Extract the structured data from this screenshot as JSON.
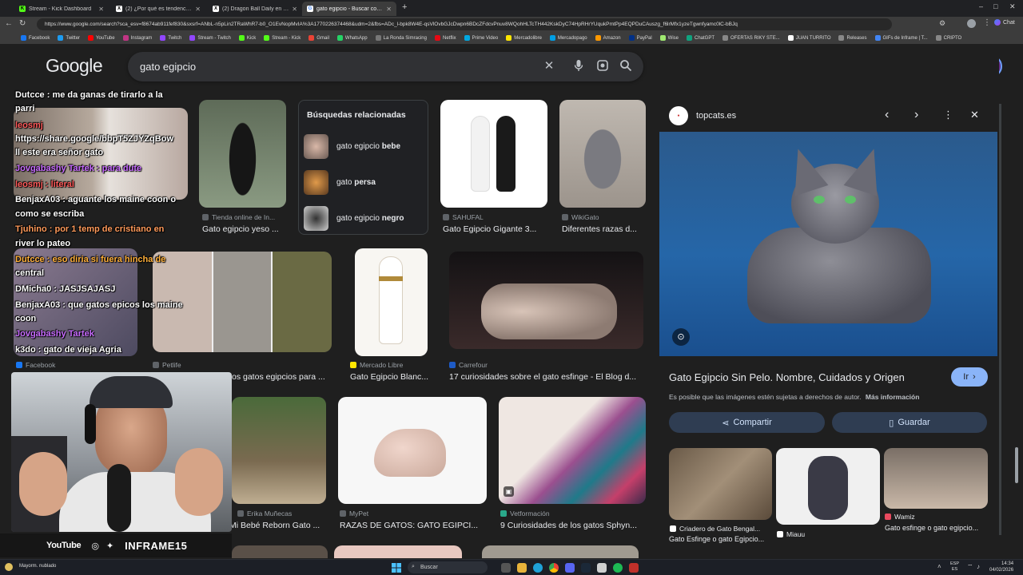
{
  "browser": {
    "tabs": [
      {
        "label": "Stream - Kick Dashboard",
        "icon": "kick-icon"
      },
      {
        "label": "(2) ¿Por qué es tendencia? (@porq",
        "icon": "x-icon"
      },
      {
        "label": "(2) Dragon Ball Daily en X: \"Beerus",
        "icon": "x-icon"
      },
      {
        "label": "gato egipcio - Buscar con Google",
        "icon": "google-icon"
      }
    ],
    "url": "https://www.google.com/search?sca_esv=f8674ab911fef830&sxsrf=ANbL-n5pLin2TRaWhR7-b0_O1EvNopMvIA%3A1770226374468&udm=2&fbs=ADc_l-bpk8W4E-qsVlOvbGJcDwpn6BDcZFdcvPnuv8WQohHLTcTH442KskDyC74HpRHrYUqukPmtPp4EQPDuCAuszg_f6lrMfx1yzeTgwnfyamc0lC-bBJq",
    "bookmarks": [
      "Facebook",
      "Twitter",
      "YouTube",
      "Instagram",
      "Twitch",
      "Stream - Twitch",
      "Kick",
      "Stream - Kick",
      "Gmail",
      "WhatsApp",
      "La Ronda Simracing",
      "Netflix",
      "Prime Video",
      "Mercadolibre",
      "Mercadopago",
      "Amazon",
      "PayPal",
      "Wise",
      "ChatGPT",
      "OFERTAS RIKY STE...",
      "JUAN TURRITO",
      "Releases",
      "GIFs de Inframe | T...",
      "CRIPTO"
    ],
    "chat_label": "Chat"
  },
  "google": {
    "logo": "Google",
    "query": "gato egipcio",
    "related": {
      "title": "Búsquedas relacionadas",
      "items": [
        {
          "prefix": "gato egipcio ",
          "bold": "bebe"
        },
        {
          "prefix": "gato ",
          "bold": "persa"
        },
        {
          "prefix": "gato egipcio ",
          "bold": "negro"
        }
      ]
    },
    "results": [
      {
        "source": "Tienda online de In...",
        "title": "Gato egipcio yeso ..."
      },
      {
        "source": "SAHUFAL",
        "title": "Gato Egipcio Gigante 3..."
      },
      {
        "source": "WikiGato",
        "title": "Diferentes razas d..."
      },
      {
        "source": "Facebook",
        "title": ""
      },
      {
        "source": "Petlife",
        "title": "os gatos egipcios para ..."
      },
      {
        "source": "Mercado Libre",
        "title": "Gato Egipcio Blanc..."
      },
      {
        "source": "Carrefour",
        "title": "17 curiosidades sobre el gato esfinge - El Blog d..."
      },
      {
        "source": "Erika Muñecas",
        "title": "Mi Bebé Reborn Gato ..."
      },
      {
        "source": "MyPet",
        "title": "RAZAS DE GATOS: GATO EGIPCI..."
      },
      {
        "source": "Vetformación",
        "title": "9 Curiosidades de los gatos Sphyn..."
      }
    ]
  },
  "panel": {
    "site": "topcats.es",
    "title": "Gato Egipcio Sin Pelo. Nombre, Cuidados y Origen",
    "go_label": "Ir",
    "copyright": "Es posible que las imágenes estén sujetas a derechos de autor.",
    "more_info": "Más información",
    "share_label": "Compartir",
    "save_label": "Guardar",
    "related": [
      {
        "source": "Criadero de Gato Bengal...",
        "title": "Gato Esfinge o gato Egipcio..."
      },
      {
        "source": "Miauu",
        "title": ""
      },
      {
        "source": "Wamiz",
        "title": "Gato esfinge o gato egipcio..."
      }
    ]
  },
  "stream": {
    "chat": [
      "Dutcce : me da ganas de tirarlo a la",
      "parri",
      "leosmj",
      "https://share.google/bbpT5ZJYZqBow",
      "ll este era señor gato",
      "Jovgabashy Tartek : para dute",
      "leosmj : literal",
      "BenjaxA03 : aguante los maine coon o",
      "como se escriba",
      "Tjuhino : por 1 temp de cristiano en",
      "river lo pateo",
      "Dutcce : eso diria si fuera hincha de",
      "central",
      "DMicha0 : JASJSAJASJ",
      "BenjaxA03 : que gatos epicos los maine",
      "coon",
      "Jovgabashy Tartek",
      "k3do : gato de vieja Agria"
    ],
    "social_youtube": "YouTube",
    "channel": "INFRAME15"
  },
  "taskbar": {
    "weather": "Mayorm. nublado",
    "search_placeholder": "Buscar",
    "lang": "ESP",
    "region": "ES",
    "time": "14:34",
    "date": "04/02/2026"
  }
}
